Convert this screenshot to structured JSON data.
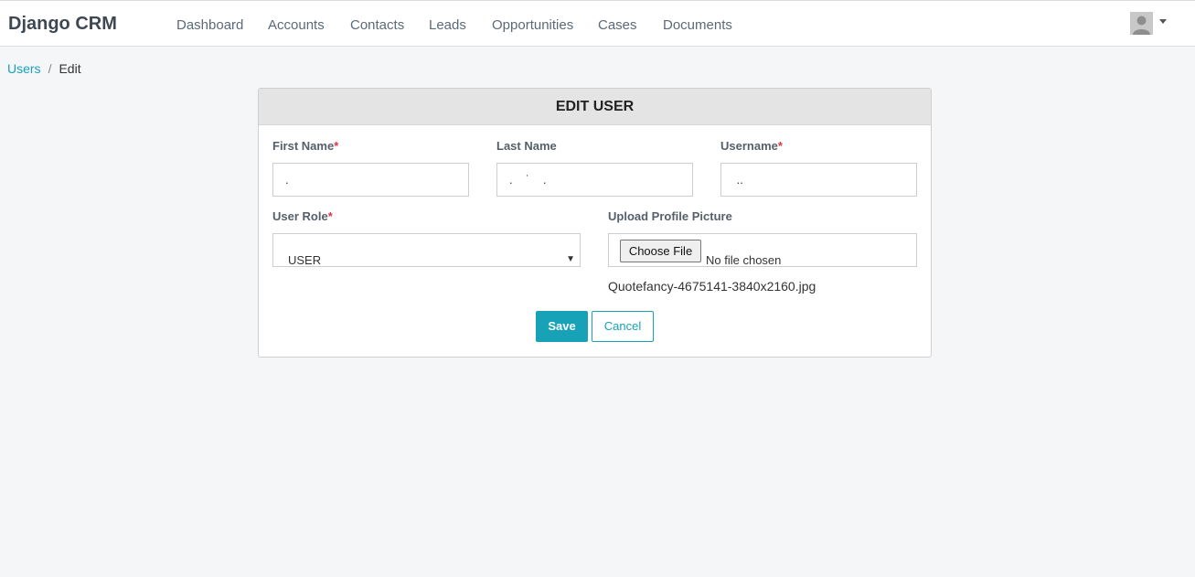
{
  "brand": "Django CRM",
  "nav": {
    "items": [
      {
        "label": "Dashboard"
      },
      {
        "label": "Accounts"
      },
      {
        "label": "Contacts"
      },
      {
        "label": "Leads"
      },
      {
        "label": "Opportunities"
      },
      {
        "label": "Cases"
      },
      {
        "label": "Documents"
      }
    ]
  },
  "user_menu": {
    "avatar_icon": "user-avatar-icon",
    "caret_icon": "caret-down-icon"
  },
  "breadcrumb": {
    "parent": "Users",
    "separator": "/",
    "current": "Edit"
  },
  "form": {
    "title": "EDIT USER",
    "required_marker": "*",
    "first_name": {
      "label": "First Name",
      "value": "."
    },
    "last_name": {
      "label": "Last Name",
      "value": ".    ˙    ."
    },
    "username": {
      "label": "Username",
      "value": " .."
    },
    "role": {
      "label": "User Role",
      "value": "USER"
    },
    "picture": {
      "label": "Upload Profile Picture",
      "button": "Choose File",
      "status": "No file chosen",
      "current_file": "Quotefancy-4675141-3840x2160.jpg"
    },
    "save_label": "Save",
    "cancel_label": "Cancel"
  },
  "colors": {
    "accent": "#17a2b8",
    "required": "#dc3545",
    "header_bg": "#e4e4e4",
    "page_bg": "#f5f6f8"
  }
}
